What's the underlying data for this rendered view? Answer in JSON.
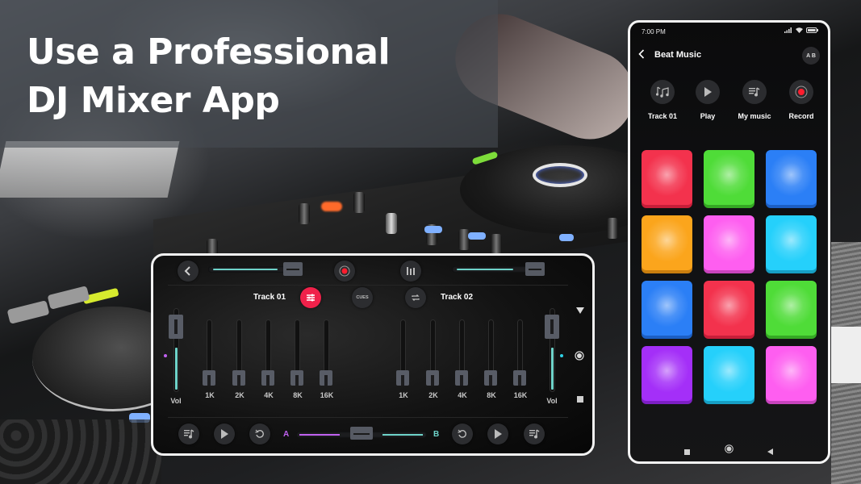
{
  "headline": {
    "line1": "Use a Professional",
    "line2": "DJ Mixer App"
  },
  "mixer": {
    "top_bar": {
      "back_icon": "chevron-left-icon",
      "record_icon": "record-icon",
      "equalizer_icon": "equalizer-bars-icon",
      "left_pitch_slider": 0.6,
      "right_pitch_slider": 0.6
    },
    "deck_a": {
      "track_label": "Track 01",
      "mode_button_icon": "sliders-icon",
      "eq_bands": [
        "1K",
        "2K",
        "4K",
        "8K",
        "16K"
      ],
      "eq_levels": [
        0,
        0,
        0,
        0,
        0
      ],
      "vol_label": "Vol",
      "volume": 0.95
    },
    "center": {
      "cues_label": "CUES",
      "loop_icon": "repeat-icon"
    },
    "deck_b": {
      "track_label": "Track 02",
      "eq_bands": [
        "1K",
        "2K",
        "4K",
        "8K",
        "16K"
      ],
      "eq_levels": [
        0,
        0,
        0,
        0,
        0
      ],
      "vol_label": "Vol",
      "volume": 0.95
    },
    "bottom_bar": {
      "crossfader_a_label": "A",
      "crossfader_b_label": "B",
      "crossfader_position": 0.5,
      "left_buttons": [
        "music-list-icon",
        "play-icon",
        "reset-icon"
      ],
      "right_buttons": [
        "reset-icon",
        "play-icon",
        "music-list-icon"
      ]
    },
    "side_nav": [
      "triangle-down-icon",
      "circle-icon",
      "square-icon"
    ],
    "colors": {
      "accent_red": "#f0214a",
      "teal": "#6ed3c9",
      "violet": "#c061f0"
    }
  },
  "phone": {
    "status_time": "7:00 PM",
    "title": "Beat Music",
    "ab_label": "A B",
    "actions": [
      {
        "label": "Track 01",
        "icon": "music-notes-icon"
      },
      {
        "label": "Play",
        "icon": "play-icon"
      },
      {
        "label": "My music",
        "icon": "music-list-icon"
      },
      {
        "label": "Record",
        "icon": "record-icon"
      }
    ],
    "pads": [
      {
        "color": "#f3324d",
        "shade": "#c81e39"
      },
      {
        "color": "#4fdc38",
        "shade": "#35a824"
      },
      {
        "color": "#2b7ff6",
        "shade": "#1c5fc4"
      },
      {
        "color": "#fba51c",
        "shade": "#c97e0e"
      },
      {
        "color": "#fe5ef0",
        "shade": "#c844bd"
      },
      {
        "color": "#25d0fb",
        "shade": "#179fc4"
      },
      {
        "color": "#2b7ff6",
        "shade": "#1c5fc4"
      },
      {
        "color": "#f3324d",
        "shade": "#c81e39"
      },
      {
        "color": "#4fdc38",
        "shade": "#35a824"
      },
      {
        "color": "#a42ff8",
        "shade": "#7d1fc4"
      },
      {
        "color": "#25d0fb",
        "shade": "#179fc4"
      },
      {
        "color": "#fe5ef0",
        "shade": "#c844bd"
      }
    ],
    "nav": [
      "square-icon",
      "home-circle-icon",
      "back-triangle-icon"
    ]
  }
}
